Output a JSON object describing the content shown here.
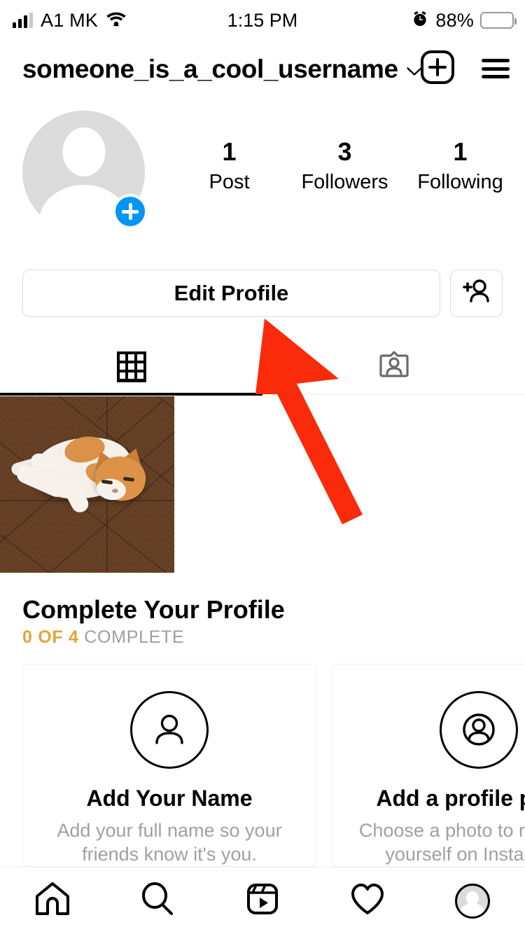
{
  "status_bar": {
    "carrier": "A1 MK",
    "time": "1:15 PM",
    "battery_percent": "88%",
    "signal_icon": "signal-bars-icon",
    "wifi_icon": "wifi-icon",
    "alarm_icon": "alarm-clock-icon",
    "battery_icon": "battery-icon"
  },
  "header": {
    "username": "someone_is_a_cool_username",
    "chevron_icon": "chevron-down-icon",
    "new_post_icon": "plus-box-icon",
    "menu_icon": "hamburger-menu-icon"
  },
  "profile": {
    "avatar_icon": "default-avatar-icon",
    "avatar_add_badge": "plus-badge-icon",
    "stats": [
      {
        "value": "1",
        "label": "Post"
      },
      {
        "value": "3",
        "label": "Followers"
      },
      {
        "value": "1",
        "label": "Following"
      }
    ],
    "edit_profile_label": "Edit Profile",
    "add_person_icon": "add-person-icon"
  },
  "tabs": [
    {
      "name": "grid",
      "icon": "grid-icon",
      "active": true
    },
    {
      "name": "tagged",
      "icon": "tagged-photos-icon",
      "active": false
    }
  ],
  "posts": [
    {
      "alt": "orange and white cat lying on dark brown herringbone wood floor"
    }
  ],
  "complete_profile": {
    "title": "Complete Your Profile",
    "progress_count": "0 OF 4",
    "progress_word": "COMPLETE",
    "progress_color": "#E8A33D",
    "cards": [
      {
        "icon": "person-outline-icon",
        "title": "Add Your Name",
        "description": "Add your full name so your friends know it's you."
      },
      {
        "icon": "profile-photo-icon",
        "title": "Add a profile photo",
        "description": "Choose a photo to represent yourself on Instagram."
      }
    ]
  },
  "bottom_nav": [
    {
      "icon": "home-icon",
      "active": false
    },
    {
      "icon": "search-icon",
      "active": false
    },
    {
      "icon": "reels-icon",
      "active": false
    },
    {
      "icon": "heart-icon",
      "active": false
    },
    {
      "icon": "profile-avatar-icon",
      "active": true
    }
  ],
  "annotation": {
    "arrow_icon": "red-arrow-annotation",
    "color": "#FA2B0A",
    "points_at": "Edit Profile"
  },
  "colors": {
    "accent_blue": "#0095F6",
    "border_gray": "#DBDBDB",
    "muted_gray": "#A0A0A0",
    "avatar_gray": "#DBDBDB"
  }
}
